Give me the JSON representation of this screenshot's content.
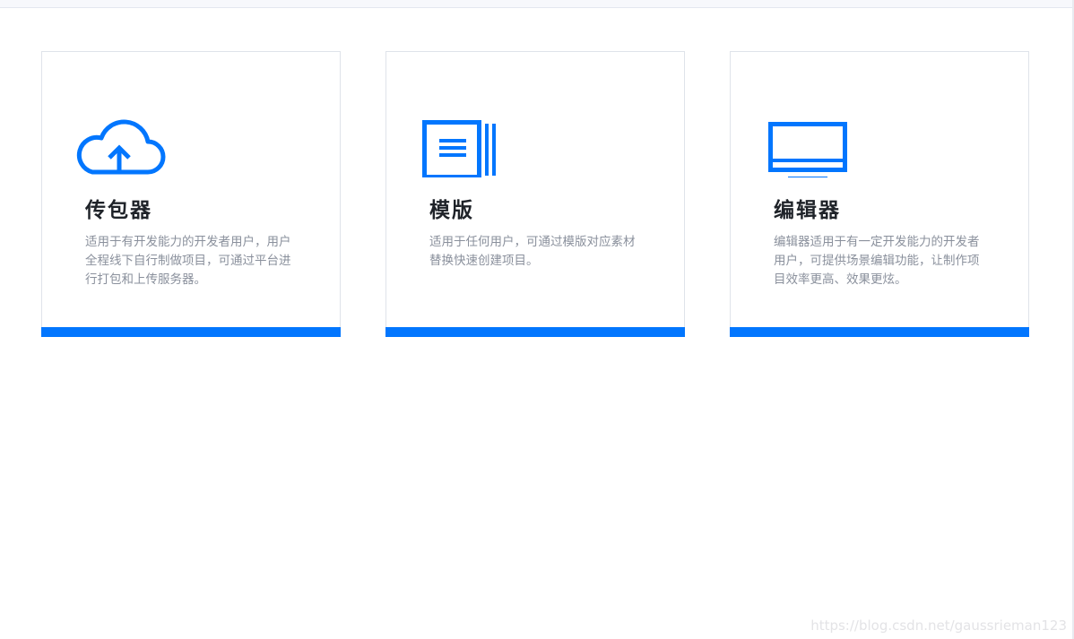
{
  "accent_color": "#0276FE",
  "cards": [
    {
      "icon": "cloud-upload-icon",
      "title": "传包器",
      "description": "适用于有开发能力的开发者用户，用户全程线下自行制做项目，可通过平台进行打包和上传服务器。"
    },
    {
      "icon": "template-stack-icon",
      "title": "模版",
      "description": "适用于任何用户，可通过模版对应素材替换快速创建项目。"
    },
    {
      "icon": "monitor-icon",
      "title": "编辑器",
      "description": "编辑器适用于有一定开发能力的开发者用户，可提供场景编辑功能，让制作项目效率更高、效果更炫。"
    }
  ],
  "watermark": "https://blog.csdn.net/gaussrieman123"
}
